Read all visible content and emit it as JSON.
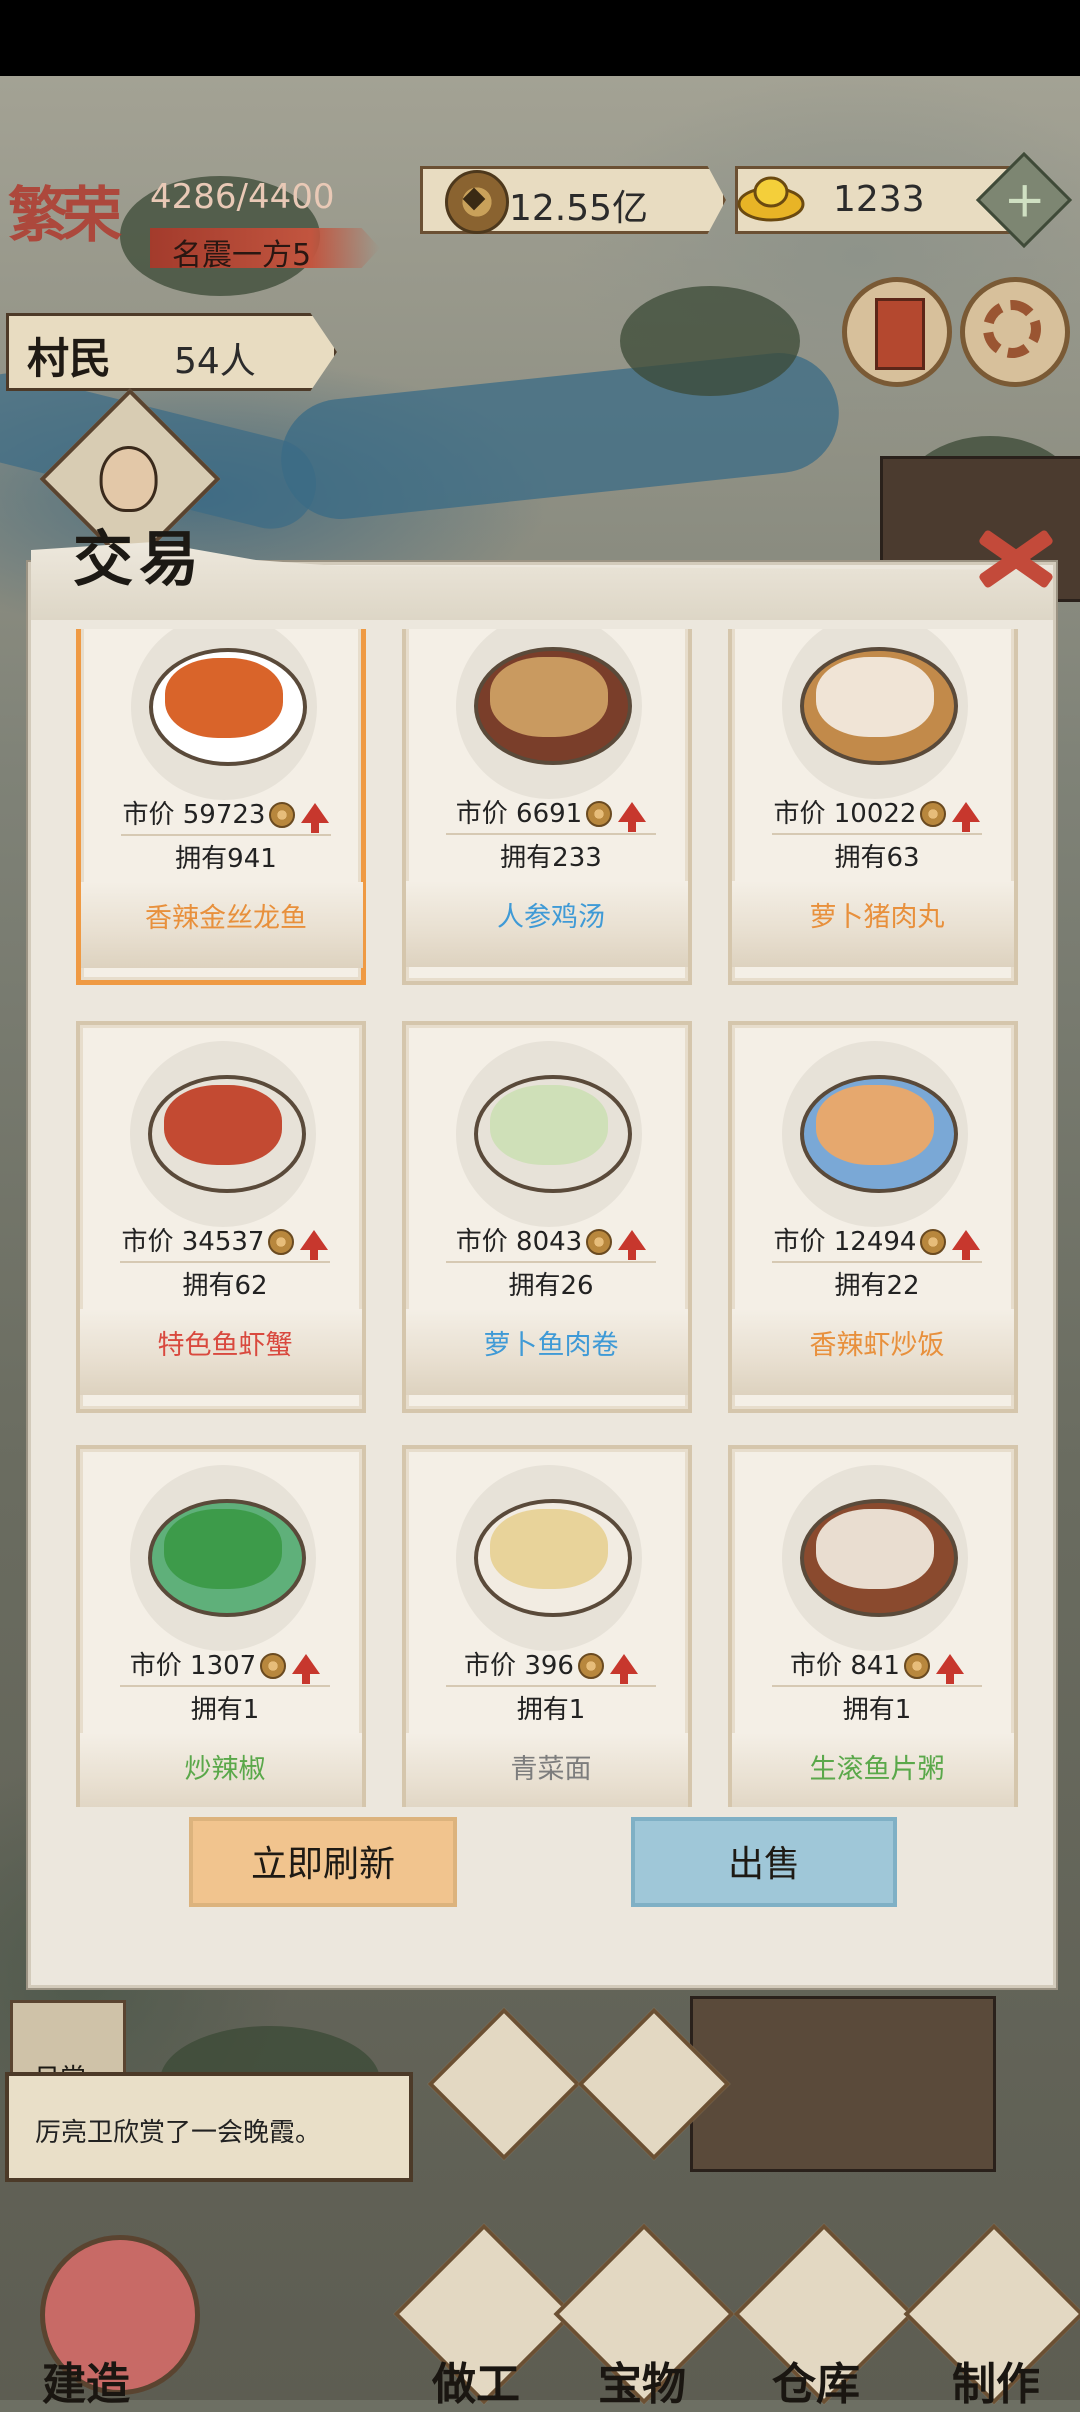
{
  "hud": {
    "fame_glyph": "繁荣",
    "fame_progress": "4286/4400",
    "fame_title": "名震一方5",
    "copper": "12.55亿",
    "gold": "1233",
    "villager_label": "村民",
    "villager_count": "54人"
  },
  "modal": {
    "title": "交易",
    "items": [
      {
        "name": "香辣金丝龙鱼",
        "price": "59723",
        "owned": "拥有941",
        "name_color": "#e8903c",
        "selected": true
      },
      {
        "name": "人参鸡汤",
        "price": "6691",
        "owned": "拥有233",
        "name_color": "#3f9ad6",
        "selected": false
      },
      {
        "name": "萝卜猪肉丸",
        "price": "10022",
        "owned": "拥有63",
        "name_color": "#e8903c",
        "selected": false
      },
      {
        "name": "特色鱼虾蟹",
        "price": "34537",
        "owned": "拥有62",
        "name_color": "#d9493e",
        "selected": false
      },
      {
        "name": "萝卜鱼肉卷",
        "price": "8043",
        "owned": "拥有26",
        "name_color": "#3f9ad6",
        "selected": false
      },
      {
        "name": "香辣虾炒饭",
        "price": "12494",
        "owned": "拥有22",
        "name_color": "#e8903c",
        "selected": false
      },
      {
        "name": "炒辣椒",
        "price": "1307",
        "owned": "拥有1",
        "name_color": "#5aa84a",
        "selected": false
      },
      {
        "name": "青菜面",
        "price": "396",
        "owned": "拥有1",
        "name_color": "#7d7d7d",
        "selected": false
      },
      {
        "name": "生滚鱼片粥",
        "price": "841",
        "owned": "拥有1",
        "name_color": "#5aa84a",
        "selected": false
      }
    ],
    "price_prefix": "市价",
    "refresh_label": "立即刷新",
    "sell_label": "出售"
  },
  "daily": {
    "tag": "日常",
    "log": "厉亮卫欣赏了一会晚霞。"
  },
  "nav": {
    "build": "建造",
    "work": "做工",
    "treasure": "宝物",
    "warehouse": "仓库",
    "craft": "制作"
  },
  "colors": {
    "accent_orange": "#ef9a43",
    "sell_blue": "#9fc7d8",
    "refresh_peach": "#f1c48e",
    "trend_up_red": "#c7372d"
  }
}
